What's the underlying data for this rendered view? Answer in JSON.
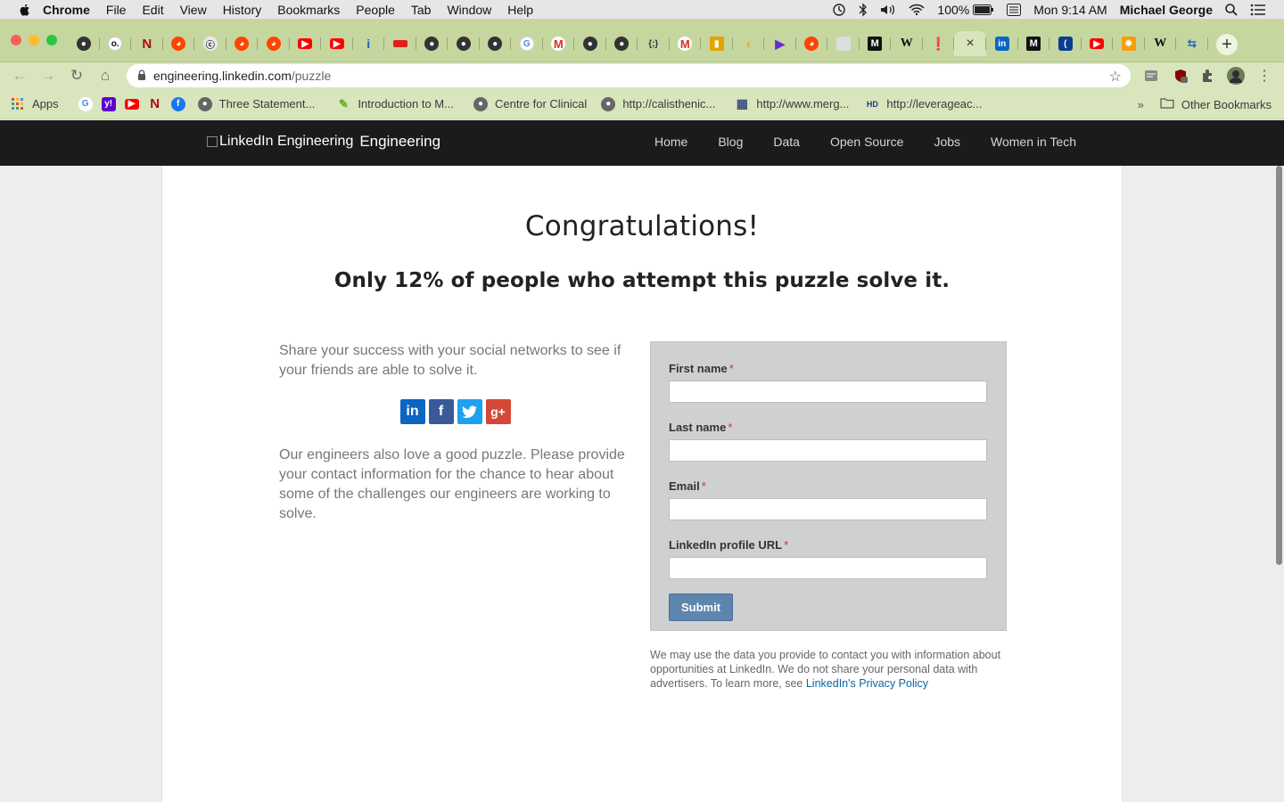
{
  "menubar": {
    "app": "Chrome",
    "items": [
      "File",
      "Edit",
      "View",
      "History",
      "Bookmarks",
      "People",
      "Tab",
      "Window",
      "Help"
    ],
    "battery": "100%",
    "time": "Mon 9:14 AM",
    "user": "Michael George"
  },
  "browser": {
    "url_host": "engineering.linkedin.com",
    "url_path": "/puzzle",
    "tab_close": "×",
    "new_tab": "+"
  },
  "bookmarks": {
    "apps": "Apps",
    "items": [
      "Three Statement...",
      "Introduction to M...",
      "Centre for Clinical",
      "http://calisthenic...",
      "http://www.merg...",
      "http://leverageac..."
    ],
    "overflow": "»",
    "other": "Other Bookmarks"
  },
  "site": {
    "logo_alt": "LinkedIn Engineering",
    "logo_label": "Engineering",
    "nav": [
      "Home",
      "Blog",
      "Data",
      "Open Source",
      "Jobs",
      "Women in Tech"
    ]
  },
  "main": {
    "heading": "Congratulations!",
    "subheading": "Only 12% of people who attempt this puzzle solve it.",
    "share_text": "Share your success with your social networks to see if your friends are able to solve it.",
    "contact_text": "Our engineers also love a good puzzle. Please provide your contact information for the chance to hear about some of the challenges our engineers are working to solve."
  },
  "form": {
    "first_name": "First name",
    "last_name": "Last name",
    "email": "Email",
    "linkedin_url": "LinkedIn profile URL",
    "required_mark": "*",
    "submit": "Submit"
  },
  "disclaimer": {
    "text": "We may use the data you provide to contact you with information about opportunities at LinkedIn. We do not share your personal data with advertisers. To learn more, see ",
    "link": "LinkedIn's Privacy Policy"
  },
  "colors": {
    "tabstrip": "#c5d79f",
    "nav_bg": "#1b1b1b",
    "form_bg": "#cfd0d2",
    "submit": "#5d86ae",
    "link": "#0a66a2"
  }
}
